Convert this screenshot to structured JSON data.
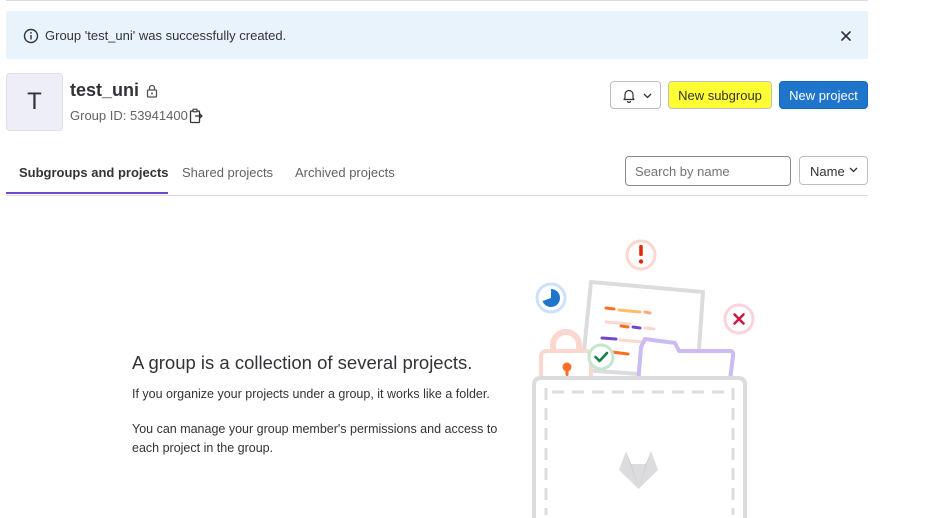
{
  "alert": {
    "message": "Group 'test_uni' was successfully created.",
    "icon": "info-icon",
    "close_icon": "close-icon"
  },
  "group": {
    "avatar_letter": "T",
    "name": "test_uni",
    "visibility_icon": "lock-icon",
    "id_text": "Group ID: 53941400",
    "copy_icon": "copy-icon"
  },
  "actions": {
    "notifications_icon": "bell-icon",
    "new_subgroup": "New subgroup",
    "new_project": "New project",
    "highlight_color": "#ffff33",
    "primary_color": "#1f75cb"
  },
  "tabs": [
    {
      "label": "Subgroups and projects",
      "active": true
    },
    {
      "label": "Shared projects",
      "active": false
    },
    {
      "label": "Archived projects",
      "active": false
    }
  ],
  "filter": {
    "search_placeholder": "Search by name",
    "sort_label": "Name"
  },
  "empty_state": {
    "title": "A group is a collection of several projects.",
    "line1": "If you organize your projects under a group, it works like a folder.",
    "line2": "You can manage your group member's permissions and access to each project in the group."
  }
}
